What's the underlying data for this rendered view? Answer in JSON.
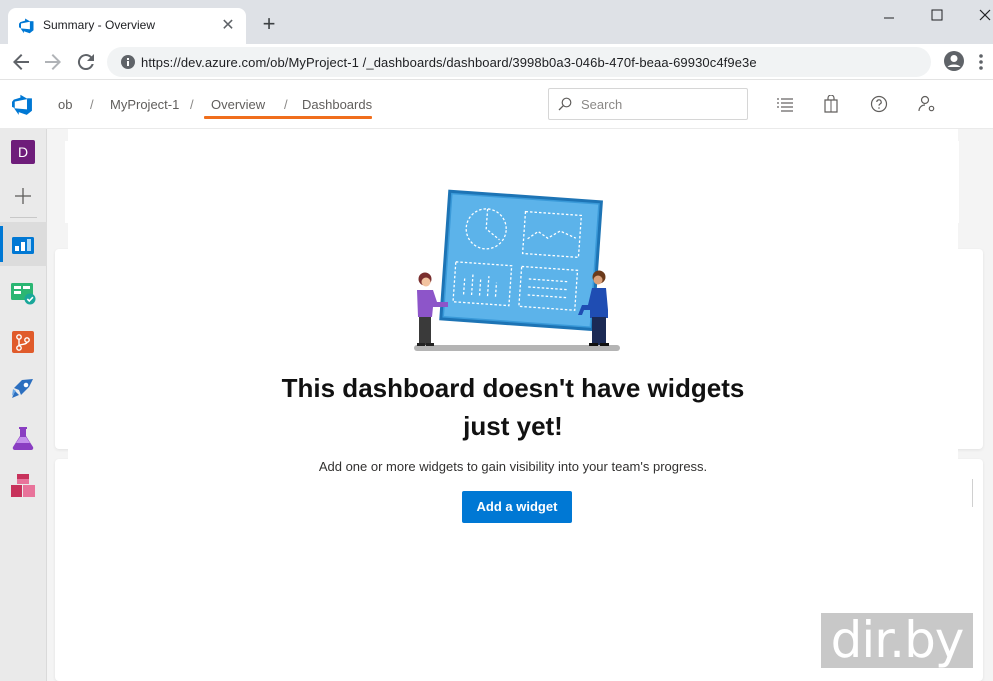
{
  "browser": {
    "tab_title": "Summary - Overview",
    "new_tab": "+",
    "url": "https://dev.azure.com/ob/MyProject-1 /_dashboards/dashboard/3998b0a3-046b-470f-beaa-69930c4f9e3e"
  },
  "header": {
    "breadcrumbs": [
      "ob",
      "MyProject-1",
      "Overview",
      "Dashboards"
    ],
    "separator": "/",
    "search_placeholder": "Search",
    "accent_color": "#f06e1c"
  },
  "rail": {
    "org_initial": "D",
    "items": [
      "Overview",
      "Boards",
      "Repos",
      "Pipelines",
      "Test Plans",
      "Artifacts"
    ],
    "active": "Overview"
  },
  "empty_state": {
    "title_line1": "This dashboard doesn't have widgets",
    "title_line2": "just yet!",
    "subtitle": "Add one or more widgets to gain visibility into your team's progress.",
    "button": "Add a widget",
    "button_color": "#0078d4"
  },
  "watermark": "dir.by"
}
